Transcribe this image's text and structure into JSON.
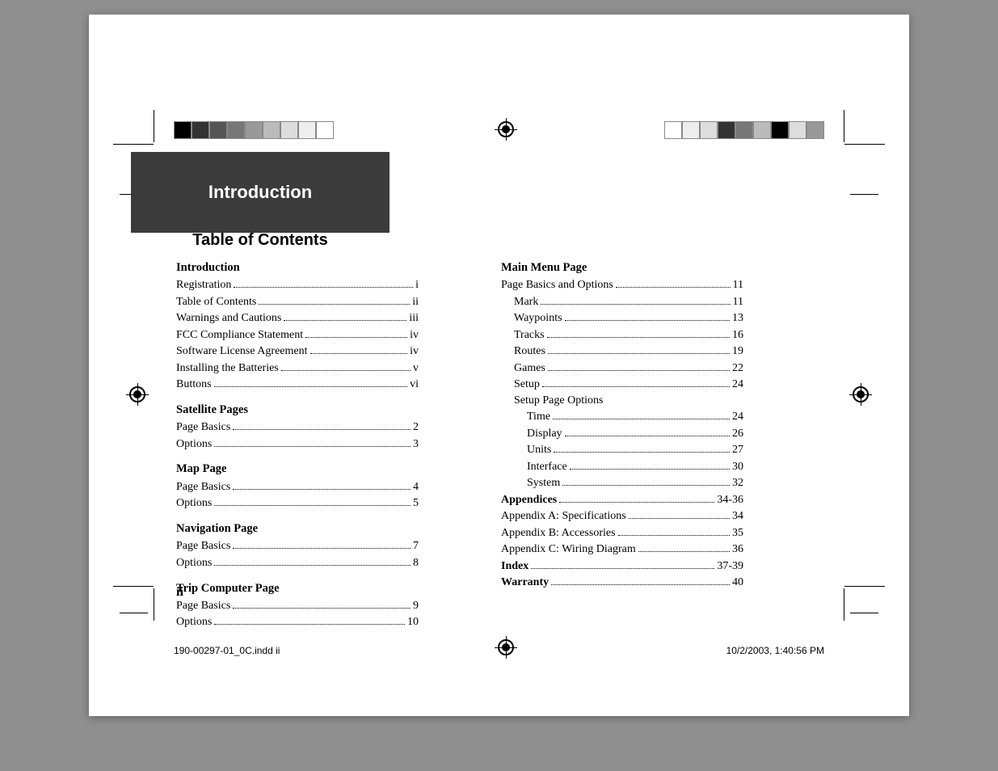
{
  "header": {
    "chapter": "Introduction",
    "title": "Table of Contents"
  },
  "left_col": {
    "sections": [
      {
        "heading": "Introduction",
        "items": [
          {
            "label": "Registration",
            "page": "i"
          },
          {
            "label": "Table of Contents",
            "page": "ii"
          },
          {
            "label": "Warnings and Cautions",
            "page": "iii"
          },
          {
            "label": "FCC Compliance Statement",
            "page": "iv"
          },
          {
            "label": "Software License Agreement",
            "page": "iv"
          },
          {
            "label": "Installing the Batteries",
            "page": "v"
          },
          {
            "label": "Buttons",
            "page": "vi"
          }
        ]
      },
      {
        "heading": "Satellite Pages",
        "items": [
          {
            "label": "Page Basics",
            "page": "2"
          },
          {
            "label": "Options",
            "page": "3"
          }
        ]
      },
      {
        "heading": "Map Page",
        "items": [
          {
            "label": "Page Basics",
            "page": "4"
          },
          {
            "label": "Options",
            "page": "5"
          }
        ]
      },
      {
        "heading": "Navigation Page",
        "items": [
          {
            "label": "Page Basics",
            "page": "7"
          },
          {
            "label": "Options",
            "page": "8"
          }
        ]
      },
      {
        "heading": "Trip Computer Page",
        "items": [
          {
            "label": "Page Basics",
            "page": "9"
          },
          {
            "label": "Options",
            "page": "10"
          }
        ]
      }
    ]
  },
  "right_col": {
    "main_heading": "Main Menu Page",
    "main_items": [
      {
        "label": "Page Basics and Options",
        "page": "11",
        "indent": 0
      },
      {
        "label": "Mark",
        "page": "11",
        "indent": 1
      },
      {
        "label": "Waypoints",
        "page": "13",
        "indent": 1
      },
      {
        "label": "Tracks",
        "page": "16",
        "indent": 1
      },
      {
        "label": "Routes",
        "page": "19",
        "indent": 1
      },
      {
        "label": "Games",
        "page": "22",
        "indent": 1
      },
      {
        "label": "Setup",
        "page": "24",
        "indent": 1
      }
    ],
    "setup_heading": "Setup Page Options",
    "setup_items": [
      {
        "label": "Time",
        "page": "24",
        "indent": 2
      },
      {
        "label": "Display",
        "page": "26",
        "indent": 2
      },
      {
        "label": "Units",
        "page": "27",
        "indent": 2
      },
      {
        "label": "Interface",
        "page": "30",
        "indent": 2
      },
      {
        "label": "System",
        "page": "32",
        "indent": 2
      }
    ],
    "tail_items": [
      {
        "label": "Appendices",
        "page": "34-36",
        "bold": true
      },
      {
        "label": "Appendix A: Specifications",
        "page": "34"
      },
      {
        "label": "Appendix B: Accessories",
        "page": "35"
      },
      {
        "label": "Appendix C: Wiring Diagram",
        "page": "36"
      },
      {
        "label": "Index",
        "page": "37-39",
        "bold": true
      },
      {
        "label": "Warranty",
        "page": "40",
        "bold": true
      }
    ]
  },
  "page_number": "ii",
  "footer": {
    "file": "190-00297-01_0C.indd   ii",
    "timestamp": "10/2/2003, 1:40:56 PM"
  }
}
